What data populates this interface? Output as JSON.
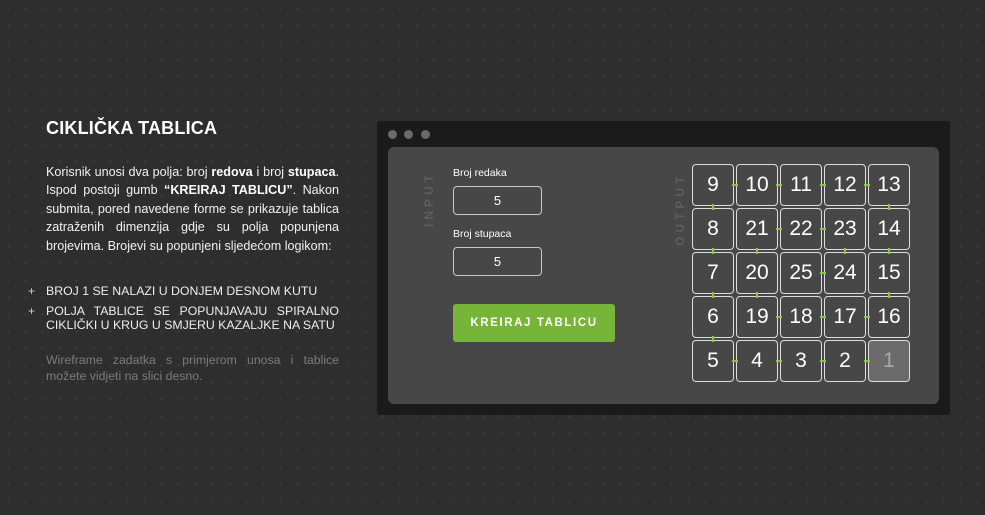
{
  "left": {
    "title": "CIKLIČKA TABLICA",
    "desc": [
      {
        "t": "Korisnik unosi dva polja: broj ",
        "b": false
      },
      {
        "t": "redova",
        "b": true
      },
      {
        "t": " i broj ",
        "b": false
      },
      {
        "t": "stupaca",
        "b": true
      },
      {
        "t": ". Ispod postoji gumb ",
        "b": false
      },
      {
        "t": "“KREIRAJ TABLICU”",
        "b": true
      },
      {
        "t": ". Nakon submita, pored navedene forme se prikazuje tablica zatraženih dimenzija gdje su polja popunjena brojevima. Brojevi su popunjeni sljedećom logikom:",
        "b": false
      }
    ],
    "rules": [
      {
        "bullet": "+",
        "text": "BROJ 1 SE NALAZI U DONJEM DESNOM KUTU"
      },
      {
        "bullet": "+",
        "text": "POLJA TABLICE SE POPUNJAVAJU SPIRALNO CIKLIČKI U KRUG U SMJERU KAZALJKE NA SATU"
      }
    ],
    "note": "Wireframe zadatka s primjerom unosa i tablice možete vidjeti na slici desno."
  },
  "window": {
    "input_label": "INPUT",
    "output_label": "OUTPUT",
    "rows_label": "Broj redaka",
    "rows_value": "5",
    "cols_label": "Broj stupaca",
    "cols_value": "5",
    "button_label": "KREIRAJ TABLICU"
  },
  "grid": {
    "rows": [
      [
        9,
        10,
        11,
        12,
        13
      ],
      [
        8,
        21,
        22,
        23,
        14
      ],
      [
        7,
        20,
        25,
        24,
        15
      ],
      [
        6,
        19,
        18,
        17,
        16
      ],
      [
        5,
        4,
        3,
        2,
        1
      ]
    ],
    "highlight": 1
  },
  "colors": {
    "accent": "#77b538",
    "link": "#8bc34a",
    "background": "#2e2e2e",
    "window": "#1b1b1b",
    "panel": "#474747"
  }
}
